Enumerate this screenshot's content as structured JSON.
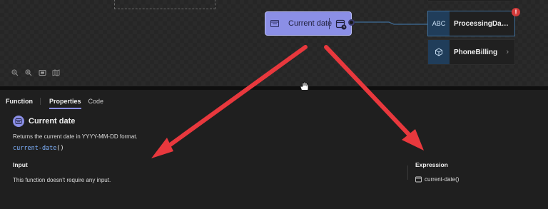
{
  "canvas": {
    "function_node": {
      "label": "Current date",
      "icon": "function-icon",
      "action_icon": "calendar-clock-icon"
    },
    "fields": [
      {
        "type_label": "ABC",
        "name": "ProcessingDate...",
        "error_badge": "!"
      },
      {
        "type_label": "",
        "type_icon": "cube-icon",
        "name": "PhoneBilling",
        "chevron": "›"
      }
    ],
    "zoom_controls": [
      "zoom-out-icon",
      "zoom-in-icon",
      "fit-view-icon",
      "map-icon"
    ]
  },
  "panel": {
    "tabs": {
      "function": "Function",
      "properties": "Properties",
      "code": "Code"
    },
    "function_title": "Current date",
    "description": "Returns the current date in YYYY-MM-DD format.",
    "signature_name": "current-date",
    "signature_parens": "()",
    "input_heading": "Input",
    "input_text": "This function doesn't require any input.",
    "expression_heading": "Expression",
    "expression_value": "current-date()"
  },
  "colors": {
    "node_accent": "#8b8fe6",
    "type_badge": "#203d5a",
    "error": "#d33a3a",
    "annotation_arrow": "#e8383d",
    "code_blue": "#7fb3ff"
  }
}
